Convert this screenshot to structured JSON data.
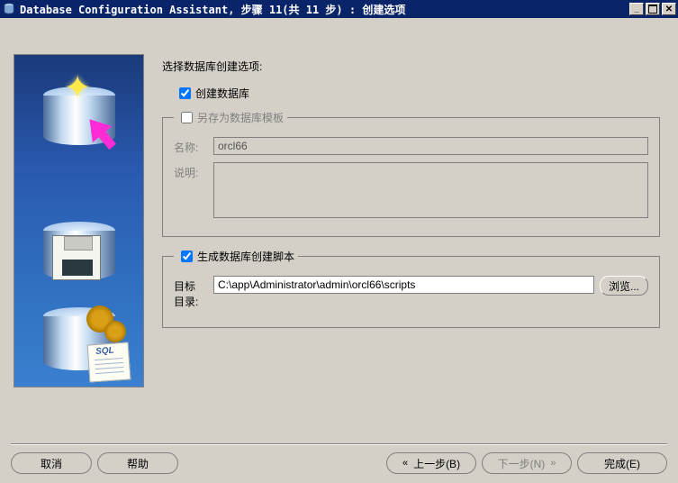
{
  "window": {
    "title": "Database Configuration Assistant, 步骤 11(共 11 步) : 创建选项"
  },
  "main": {
    "instruction": "选择数据库创建选项:",
    "createDbLabel": "创建数据库",
    "saveTemplate": {
      "legend": "另存为数据库模板",
      "nameLabel": "名称:",
      "nameValue": "orcl66",
      "descLabel": "说明:",
      "descValue": ""
    },
    "generateScripts": {
      "legend": "生成数据库创建脚本",
      "destLabelLine1": "目标",
      "destLabelLine2": "目录:",
      "destValue": "C:\\app\\Administrator\\admin\\orcl66\\scripts",
      "browseLabel": "浏览..."
    }
  },
  "footer": {
    "cancel": "取消",
    "help": "帮助",
    "back": "上一步(B)",
    "next": "下一步(N)",
    "finish": "完成(E)"
  }
}
